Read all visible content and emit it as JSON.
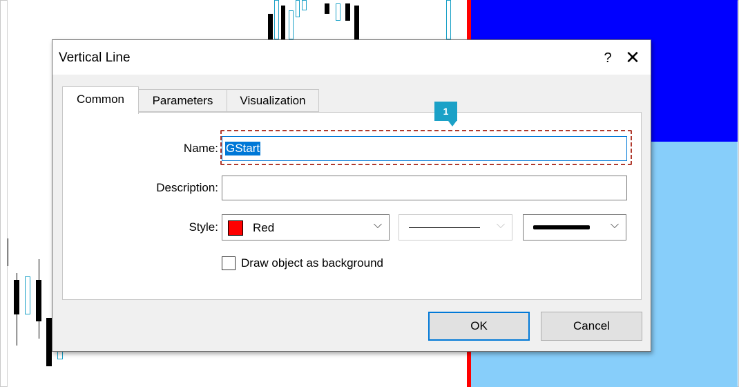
{
  "dialog": {
    "title": "Vertical Line",
    "help_label": "?",
    "close_label": "✕"
  },
  "tabs": [
    {
      "label": "Common"
    },
    {
      "label": "Parameters"
    },
    {
      "label": "Visualization"
    }
  ],
  "form": {
    "name_label": "Name:",
    "name_value": "GStart",
    "description_label": "Description:",
    "description_value": "",
    "style_label": "Style:",
    "color_value": "Red",
    "color_hex": "#ff0000",
    "draw_background_label": "Draw object as background",
    "draw_background_checked": false
  },
  "buttons": {
    "ok": "OK",
    "cancel": "Cancel"
  },
  "annotation": {
    "badge": "1"
  },
  "icons": {
    "chevron": "⌵"
  }
}
